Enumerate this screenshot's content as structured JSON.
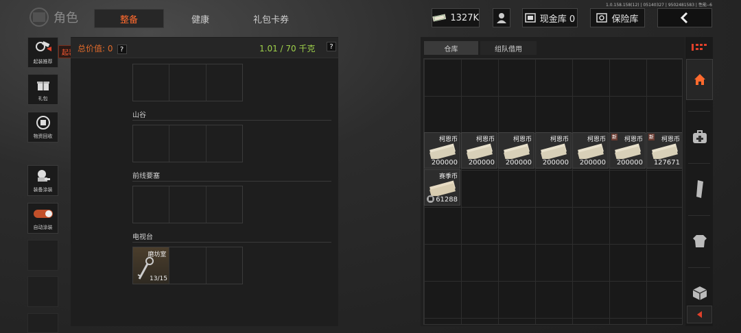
{
  "build_info": "1.0.158.158(12) | 05140327 | 9502481583 | 性能--6",
  "header": {
    "title": "角色",
    "tabs": [
      {
        "label": "整备",
        "active": true
      },
      {
        "label": "健康",
        "active": false
      },
      {
        "label": "礼包卡券",
        "active": false
      }
    ],
    "cash": "1327K",
    "cash_store": "现金库 0",
    "safe": "保险库"
  },
  "left_nav": [
    {
      "label": "起装推荐",
      "icon": "loadout-icon"
    },
    {
      "label": "礼包",
      "icon": "gift-icon"
    },
    {
      "label": "物资回收",
      "icon": "recycle-icon"
    },
    {
      "label": "装备涂装",
      "icon": "paint-icon"
    },
    {
      "label": "自动涂装",
      "icon": "toggle-icon",
      "toggle_on": true
    }
  ],
  "tooltip": "起装推荐",
  "loadout": {
    "value_label": "总价值: 0",
    "weight": "1.01 / 70 千克",
    "help": "?",
    "sections": [
      {
        "title": "山谷"
      },
      {
        "title": "前线要塞"
      },
      {
        "title": "电视台",
        "item": {
          "name": "磨坊室",
          "count": "13/15"
        }
      }
    ]
  },
  "storage": {
    "tabs": [
      {
        "label": "仓库",
        "active": true
      },
      {
        "label": "组队借用",
        "active": false
      }
    ],
    "items": [
      {
        "name": "柯恩币",
        "count": "200000",
        "new": false
      },
      {
        "name": "柯恩币",
        "count": "200000",
        "new": false
      },
      {
        "name": "柯恩币",
        "count": "200000",
        "new": false
      },
      {
        "name": "柯恩币",
        "count": "200000",
        "new": false
      },
      {
        "name": "柯恩币",
        "count": "200000",
        "new": false
      },
      {
        "name": "柯恩币",
        "count": "200000",
        "new": true
      },
      {
        "name": "柯恩币",
        "count": "127671",
        "new": true
      },
      {
        "name": "赛季币",
        "count": "61288",
        "new": false,
        "locked": true
      }
    ],
    "new_badge": "新"
  },
  "right_nav": [
    "home-icon",
    "medkit-icon",
    "magazine-icon",
    "armor-icon",
    "crate-icon"
  ],
  "colors": {
    "accent": "#ff6a2e",
    "weight": "#9fd24b"
  }
}
